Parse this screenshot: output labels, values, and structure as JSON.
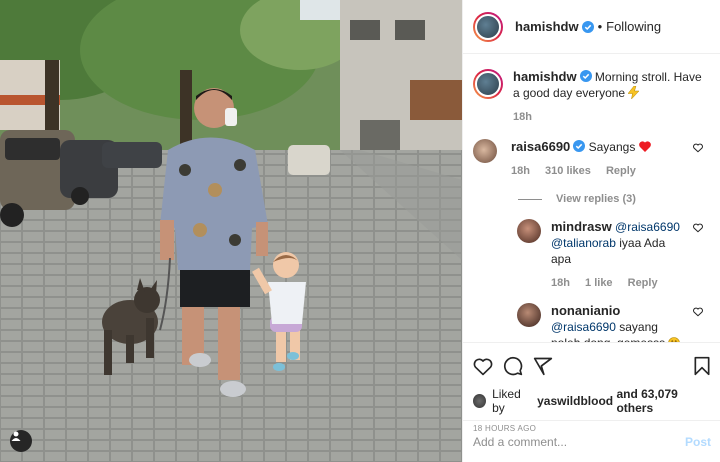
{
  "post": {
    "author": "hamishdw",
    "follow_status": "Following",
    "caption": "Morning stroll. Have a good day everyone",
    "caption_emoji": "lightning-icon",
    "caption_age": "18h",
    "likes_user": "yaswildblood",
    "likes_rest": "and 63,079 others",
    "likes_prefix": "Liked by",
    "time_ago": "18 HOURS AGO"
  },
  "comments": [
    {
      "user": "raisa6690",
      "text": "Sayangs",
      "emoji": "red-heart",
      "age": "18h",
      "likes": "310 likes",
      "reply_label": "Reply",
      "view_replies": "View replies (3)"
    }
  ],
  "replies": [
    {
      "user": "mindrasw",
      "mention1": "@raisa6690",
      "mention2": "@talianorab",
      "text": "iyaa Ada apa",
      "age": "18h",
      "likes": "1 like",
      "reply_label": "Reply"
    },
    {
      "user": "nonanianio",
      "mention1": "@raisa6690",
      "text": "sayang noleh dong, gemesss",
      "emoji": "smiling-face"
    }
  ],
  "add_comment": {
    "placeholder": "Add a comment...",
    "post_label": "Post"
  },
  "colors": {
    "verified": "#3897f0",
    "link": "#00376b",
    "post_disabled": "#b3dbff",
    "heart": "#ed1c24"
  }
}
